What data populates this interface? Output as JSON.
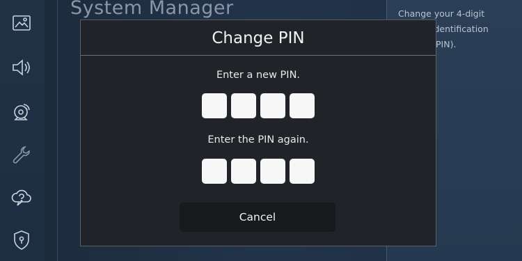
{
  "background": {
    "title": "System Manager"
  },
  "right_panel": {
    "line1": "Change your 4-digit",
    "line2": "identification",
    "line3": "PIN)."
  },
  "sidebar": {
    "items": [
      {
        "icon": "picture-icon"
      },
      {
        "icon": "sound-icon"
      },
      {
        "icon": "broadcast-icon"
      },
      {
        "icon": "wrench-icon"
      },
      {
        "icon": "cloud-help-icon"
      },
      {
        "icon": "shield-icon"
      }
    ]
  },
  "dialog": {
    "title": "Change PIN",
    "new_pin_prompt": "Enter a new PIN.",
    "confirm_pin_prompt": "Enter the PIN again.",
    "new_pin_digits": [
      "",
      "",
      "",
      ""
    ],
    "confirm_pin_digits": [
      "",
      "",
      "",
      ""
    ],
    "cancel_label": "Cancel"
  },
  "colors": {
    "dialog_bg": "#202327",
    "pin_box": "#f7f7f7",
    "text": "#f2f2f2",
    "background": "#1d2c3c"
  }
}
